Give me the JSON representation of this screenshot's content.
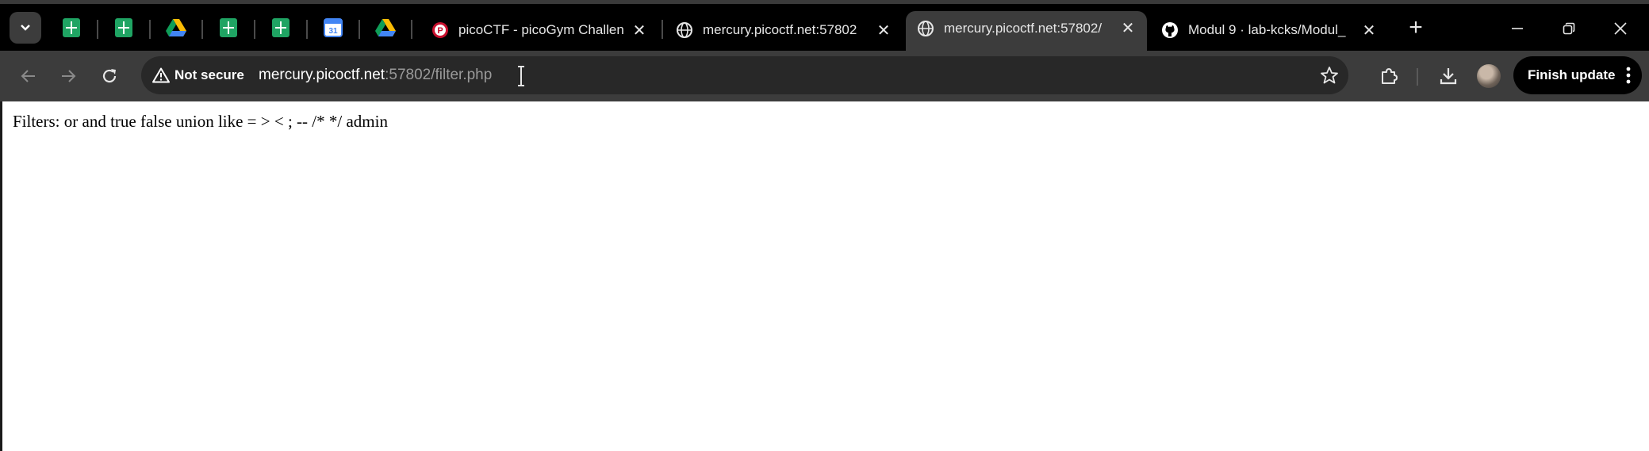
{
  "tabs": [
    {
      "title": "picoCTF - picoGym Challen",
      "favicon": "picoctf-icon",
      "active": false
    },
    {
      "title": "mercury.picoctf.net:57802",
      "favicon": "globe-icon",
      "active": false
    },
    {
      "title": "mercury.picoctf.net:57802/",
      "favicon": "globe-icon",
      "active": true
    },
    {
      "title": "Modul 9 · lab-kcks/Modul_",
      "favicon": "github-icon",
      "active": false
    }
  ],
  "pinned_tabs": [
    "sheets-icon",
    "sheets-icon",
    "drive-icon",
    "sheets-icon",
    "sheets-icon",
    "calendar-icon",
    "drive-icon"
  ],
  "calendar_day": "31",
  "toolbar": {
    "security_label": "Not secure",
    "url_host": "mercury.picoctf.net",
    "url_rest": ":57802/filter.php",
    "finish_update_label": "Finish update"
  },
  "page": {
    "filters_text": "Filters: or and true false union like = > < ; -- /* */ admin"
  },
  "colors": {
    "tabstrip_bg": "#000000",
    "toolbar_bg": "#3c3c3c",
    "omnibox_bg": "#282828",
    "sheets_green": "#1fa463"
  }
}
